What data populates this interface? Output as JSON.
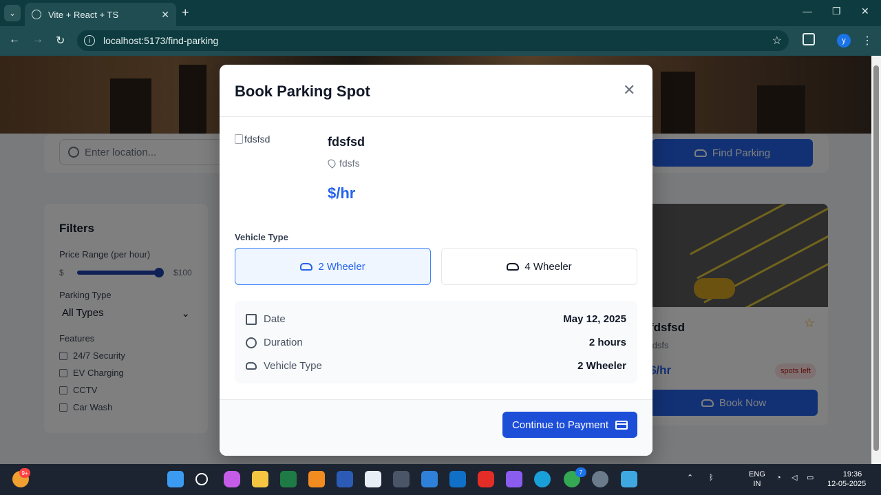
{
  "browser": {
    "tab_title": "Vite + React + TS",
    "url": "localhost:5173/find-parking",
    "profile_initial": "y"
  },
  "page": {
    "search_placeholder": "Enter location...",
    "find_button": "Find Parking",
    "filters": {
      "title": "Filters",
      "price_label": "Price Range (per hour)",
      "price_min": "$",
      "price_max": "$100",
      "price_level": 1.0,
      "type_label": "Parking Type",
      "type_value": "All Types",
      "features_label": "Features",
      "features": [
        "24/7 Security",
        "EV Charging",
        "CCTV",
        "Car Wash"
      ]
    },
    "spot_card": {
      "title": "fdsfsd",
      "location": "fdsfs",
      "price": "$/hr",
      "availability": "spots left",
      "book_button": "Book Now"
    }
  },
  "modal": {
    "title": "Book Parking Spot",
    "image_alt": "fdsfsd",
    "spot_name": "fdsfsd",
    "spot_location": "fdsfs",
    "price": "$/hr",
    "vehicle_type_label": "Vehicle Type",
    "vehicle_options": [
      "2 Wheeler",
      "4 Wheeler"
    ],
    "selected_vehicle": "2 Wheeler",
    "summary": {
      "date_label": "Date",
      "date_value": "May 12, 2025",
      "duration_label": "Duration",
      "duration_value": "2 hours",
      "vehicle_label": "Vehicle Type",
      "vehicle_value": "2 Wheeler"
    },
    "continue_button": "Continue to Payment"
  },
  "taskbar": {
    "notification_badge": "9+",
    "chrome_badge": "7",
    "lang_top": "ENG",
    "lang_bottom": "IN",
    "time": "19:36",
    "date": "12-05-2025"
  }
}
